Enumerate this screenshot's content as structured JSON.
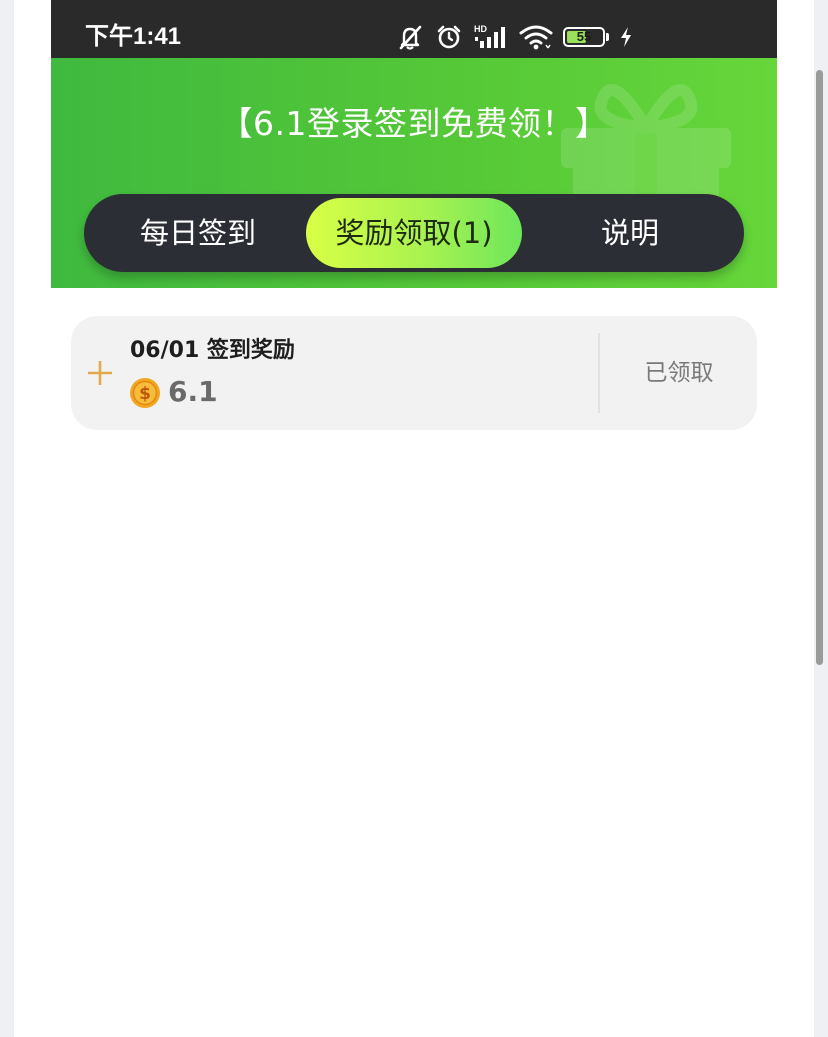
{
  "status_bar": {
    "time": "下午1:41",
    "battery_level": "55",
    "icons": [
      "mute-icon",
      "alarm-icon",
      "hd-signal-icon",
      "wifi-icon",
      "battery-icon",
      "charging-icon"
    ]
  },
  "header": {
    "title": "【6.1登录签到免费领！】",
    "background_color": "#55c838"
  },
  "tabs": [
    {
      "label": "每日签到",
      "active": false
    },
    {
      "label": "奖励领取(1)",
      "active": true
    },
    {
      "label": "说明",
      "active": false
    }
  ],
  "rewards": [
    {
      "title": "06/01 签到奖励",
      "amount": "6.1",
      "status": "已领取",
      "icon": "plus-icon",
      "coin_icon": "coin-icon"
    }
  ],
  "colors": {
    "accent_green": "#55c838",
    "tab_bar": "#2c2e36",
    "active_tab_start": "#d9ff45",
    "active_tab_end": "#6ee65a",
    "plus_gold": "#e0a94b",
    "coin_gold": "#f2a622"
  }
}
